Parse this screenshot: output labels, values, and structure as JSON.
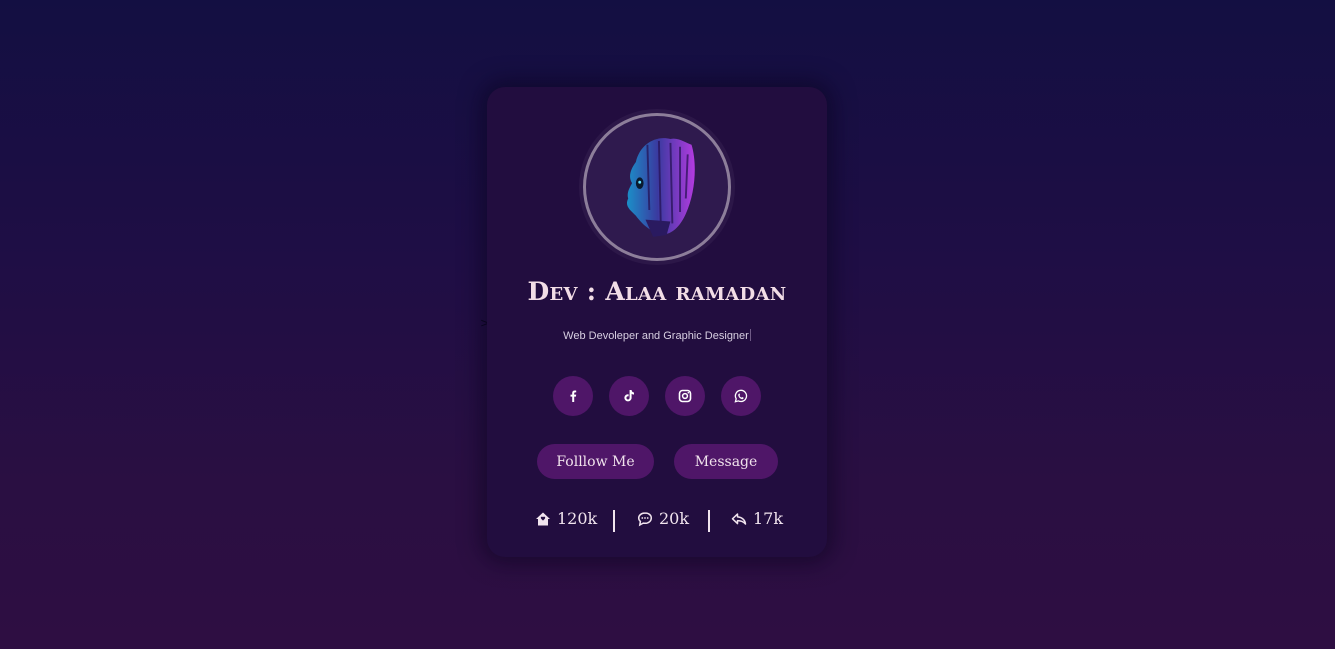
{
  "stray_char": ">",
  "profile": {
    "name": "Dev : Alaa ramadan",
    "role": "Web Devoleper and Graphic Designer"
  },
  "socials": [
    {
      "icon": "facebook-icon",
      "label": "f"
    },
    {
      "icon": "tiktok-icon"
    },
    {
      "icon": "instagram-icon"
    },
    {
      "icon": "whatsapp-icon"
    }
  ],
  "buttons": {
    "follow": "Folllow Me",
    "message": "Message"
  },
  "stats": [
    {
      "icon": "home-icon",
      "value": "120k"
    },
    {
      "icon": "comment-icon",
      "value": "20k"
    },
    {
      "icon": "reply-icon",
      "value": "17k"
    }
  ],
  "colors": {
    "card": "#220d3f",
    "accent": "#4f1668",
    "text": "#f2dde6"
  }
}
